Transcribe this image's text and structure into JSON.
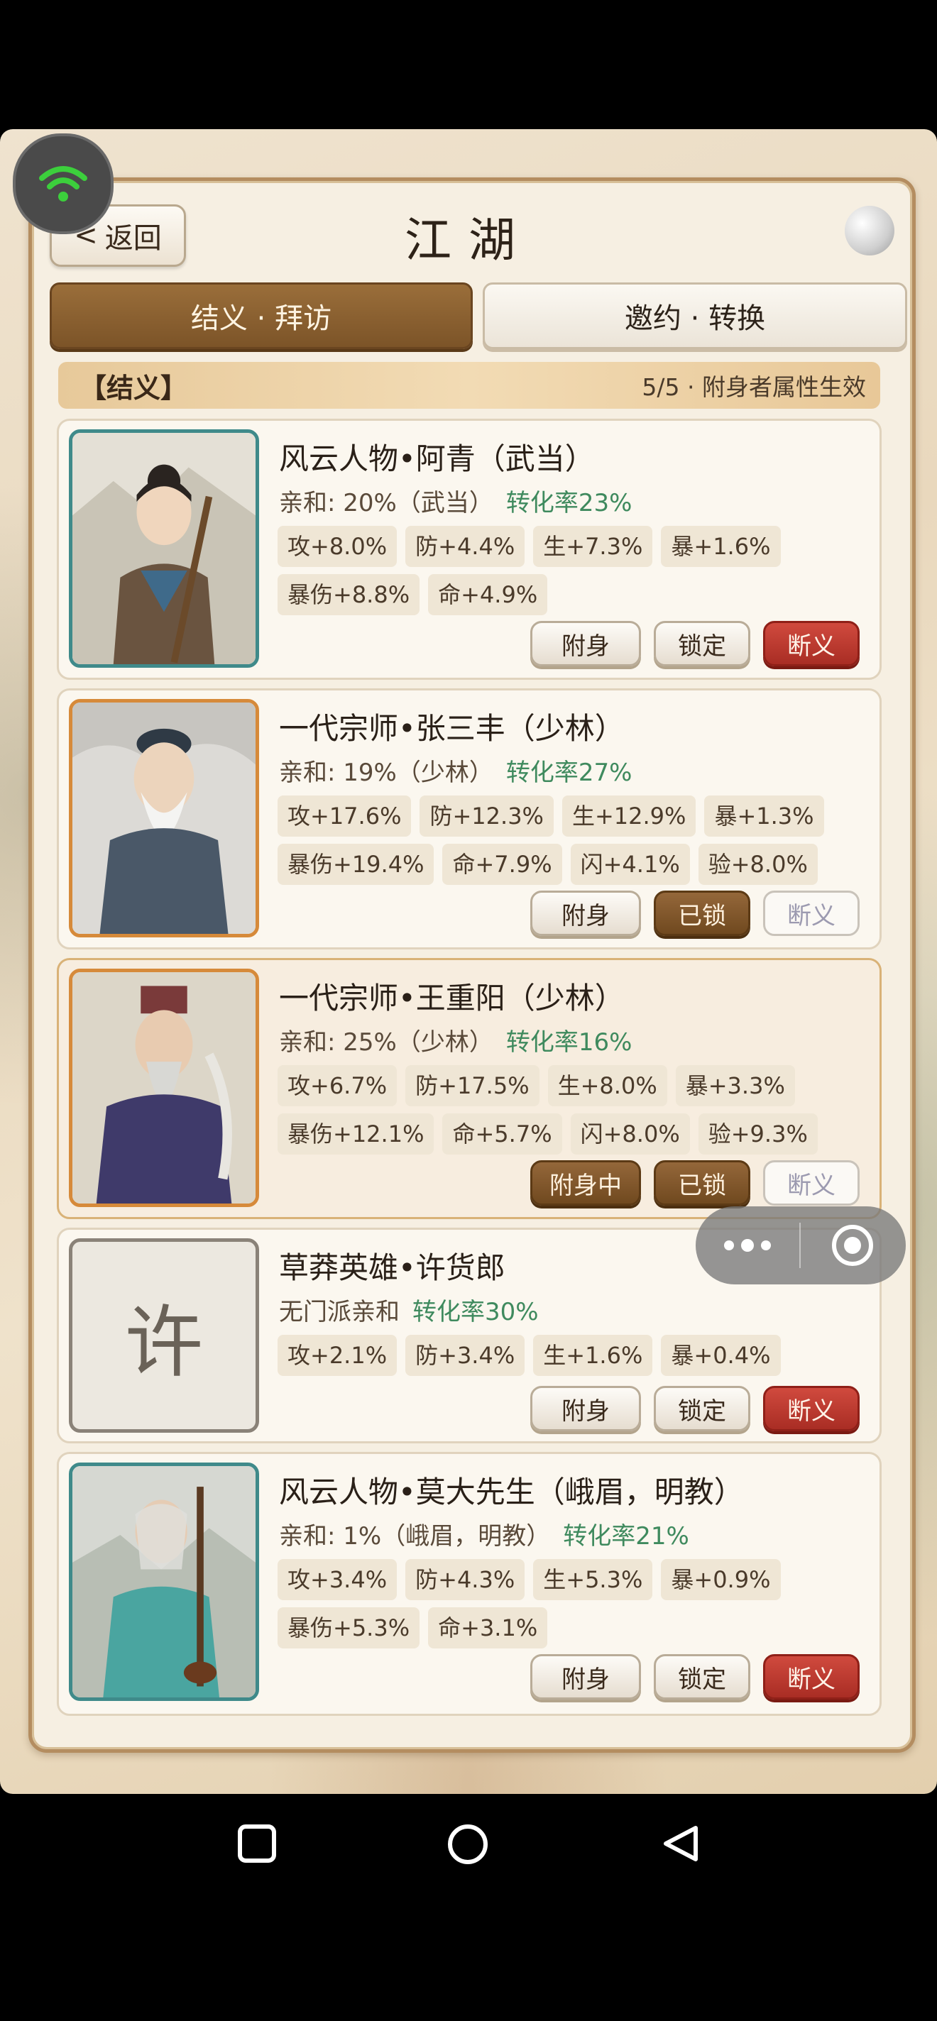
{
  "header": {
    "back_label": "返回",
    "back_chevron": "<",
    "title": "江湖"
  },
  "tabs": [
    {
      "label": "结义 · 拜访",
      "active": true
    },
    {
      "label": "邀约 · 转换",
      "active": false
    }
  ],
  "section": {
    "title": "【结义】",
    "status": "5/5 · 附身者属性生效"
  },
  "cards": [
    {
      "name": "风云人物•阿青（武当）",
      "affinity": "亲和: 20%（武当）",
      "rate": "转化率23%",
      "stats": [
        "攻+8.0%",
        "防+4.4%",
        "生+7.3%",
        "暴+1.6%",
        "暴伤+8.8%",
        "命+4.9%"
      ],
      "buttons": [
        "附身",
        "锁定",
        "断义"
      ]
    },
    {
      "name": "一代宗师•张三丰（少林）",
      "affinity": "亲和: 19%（少林）",
      "rate": "转化率27%",
      "stats": [
        "攻+17.6%",
        "防+12.3%",
        "生+12.9%",
        "暴+1.3%",
        "暴伤+19.4%",
        "命+7.9%",
        "闪+4.1%",
        "验+8.0%"
      ],
      "buttons": [
        "附身",
        "已锁",
        "断义"
      ]
    },
    {
      "name": "一代宗师•王重阳（少林）",
      "affinity": "亲和: 25%（少林）",
      "rate": "转化率16%",
      "stats": [
        "攻+6.7%",
        "防+17.5%",
        "生+8.0%",
        "暴+3.3%",
        "暴伤+12.1%",
        "命+5.7%",
        "闪+8.0%",
        "验+9.3%"
      ],
      "buttons": [
        "附身中",
        "已锁",
        "断义"
      ]
    },
    {
      "name": "草莽英雄•许货郎",
      "affinity": "无门派亲和",
      "rate": "转化率30%",
      "placeholder": "许",
      "stats": [
        "攻+2.1%",
        "防+3.4%",
        "生+1.6%",
        "暴+0.4%"
      ],
      "buttons": [
        "附身",
        "锁定",
        "断义"
      ]
    },
    {
      "name": "风云人物•莫大先生（峨眉，明教）",
      "affinity": "亲和: 1%（峨眉，明教）",
      "rate": "转化率21%",
      "stats": [
        "攻+3.4%",
        "防+4.3%",
        "生+5.3%",
        "暴+0.9%",
        "暴伤+5.3%",
        "命+3.1%"
      ],
      "buttons": [
        "附身",
        "锁定",
        "断义"
      ]
    }
  ],
  "colors": {
    "accent_brown": "#7c5428",
    "danger_red": "#b8342a",
    "rate_green": "#3f8a5e"
  },
  "icons": {
    "wifi": "wifi-icon",
    "more": "more-dots-icon",
    "close": "target-circle-icon",
    "nav": [
      "square-icon",
      "circle-icon",
      "back-triangle-icon"
    ]
  }
}
